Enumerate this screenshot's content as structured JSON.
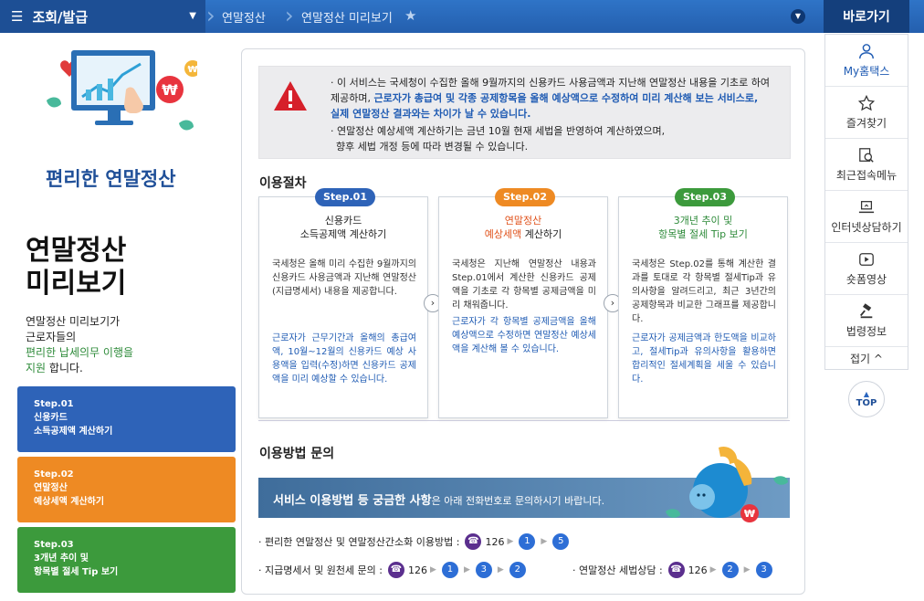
{
  "topbar": {
    "menu_label": "조회/발급",
    "crumb1": "연말정산",
    "crumb2": "연말정산 미리보기",
    "quick_title": "바로가기"
  },
  "quick_menu": [
    {
      "label": "My홈택스",
      "icon": "user-icon"
    },
    {
      "label": "즐겨찾기",
      "icon": "star-icon"
    },
    {
      "label": "최근접속메뉴",
      "icon": "recent-search-icon"
    },
    {
      "label": "인터넷상담하기",
      "icon": "laptop-icon"
    },
    {
      "label": "숏폼영상",
      "icon": "video-play-icon"
    },
    {
      "label": "법령정보",
      "icon": "gavel-icon"
    }
  ],
  "quick_fold": "접기 ^",
  "top_button": "TOP",
  "side": {
    "title": "편리한 연말정산",
    "big_title_1": "연말정산",
    "big_title_2": "미리보기",
    "desc_1": "연말정산 미리보기가",
    "desc_2": "근로자들의",
    "desc_3_green": "편리한 납세의무 이행을",
    "desc_4_green": "지원",
    "desc_4": " 합니다."
  },
  "side_steps": [
    {
      "line1": "Step.01",
      "line2": "신용카드",
      "line3": "소득공제액 계산하기",
      "color": "#2e63b8"
    },
    {
      "line1": "Step.02",
      "line2": "연말정산",
      "line3": "예상세액 계산하기",
      "color": "#ee8a23"
    },
    {
      "line1": "Step.03",
      "line2": "3개년 추이 및",
      "line3": "항목별 절세 Tip 보기",
      "color": "#3c9a3c"
    }
  ],
  "notice": {
    "l1": "· 이 서비스는 국세청이 수집한 올해 9월까지의 신용카드 사용금액과 지난해 연말정산 내용을 기초로 하여",
    "l2a": "제공하며, ",
    "l2b": "근로자가 총급여 및 각종 공제항목을 올해 예상액으로 수정하여 미리 계산해 보는 서비스로,",
    "l3": "실제 연말정산 결과와는 차이가 날 수 있습니다.",
    "l4": "· 연말정산 예상세액 계산하기는 금년 10월 현재 세법을 반영하여 계산하였으며,",
    "l5": "향후 세법 개정 등에 따라 변경될 수 있습니다."
  },
  "procedure_title": "이용절차",
  "steps": [
    {
      "badge": "Step.01",
      "badge_color": "#2e63b8",
      "h1": "신용카드",
      "h2": "소득공제액 계산하기",
      "h_color": "#222",
      "p1": "국세청은 올해 미리 수집한 9월까지의 신용카드 사용금액과 지난해 연말정산(지급명세서) 내용을 제공합니다.",
      "p2": "근로자가 근무기간과 올해의 총급여액, 10월~12월의 신용카드 예상 사용액을 입력(수정)하면 신용카드 공제액을 미리 예상할 수 있습니다."
    },
    {
      "badge": "Step.02",
      "badge_color": "#ee8a23",
      "h1": "연말정산",
      "h2a": "예상세액",
      "h2b": " 계산하기",
      "h_color": "#e0521b",
      "p1": "국세청은 지난해 연말정산 내용과 Step.01에서 계산한 신용카드 공제액을 기초로 각 항목별 공제금액을 미리 채워줍니다.",
      "p2": "근로자가 각 항목별 공제금액을 올해예상액으로 수정하면 연말정산 예상세액을 계산해 볼 수 있습니다."
    },
    {
      "badge": "Step.03",
      "badge_color": "#3c9a3c",
      "h1": "3개년 추이 및",
      "h2": "항목별 절세 Tip 보기",
      "h_color": "#2e8b3a",
      "p1": "국세청은 Step.02를 통해 계산한 결과를 토대로 각 항목별 절세Tip과 유의사항을 알려드리고, 최근 3년간의 공제항목과 비교한 그래프를 제공합니다.",
      "p2": "근로자가 공제금액과 한도액을 비교하고, 절세Tip과 유의사항을 활용하면 합리적인 절세계획을 세울 수 있습니다."
    }
  ],
  "inquiry_title": "이용방법 문의",
  "banner": {
    "bold": "서비스 이용방법 등 궁금한 사항",
    "rest": "은 아래 전화번호로 문의하시기 바랍니다."
  },
  "contacts": {
    "c1_label": "· 편리한 연말정산 및 연말정산간소화 이용방법 :",
    "c1_nums": [
      "1",
      "5"
    ],
    "c2_label": "· 지급명세서 및 원천세 문의 :",
    "c2_nums": [
      "1",
      "3",
      "2"
    ],
    "c3_label": "· 연말정산 세법상담 :",
    "c3_nums": [
      "2",
      "3"
    ],
    "phone": "126"
  },
  "colors": {
    "primary": "#245fae",
    "step1": "#2e63b8",
    "step2": "#ee8a23",
    "step3": "#3c9a3c"
  }
}
